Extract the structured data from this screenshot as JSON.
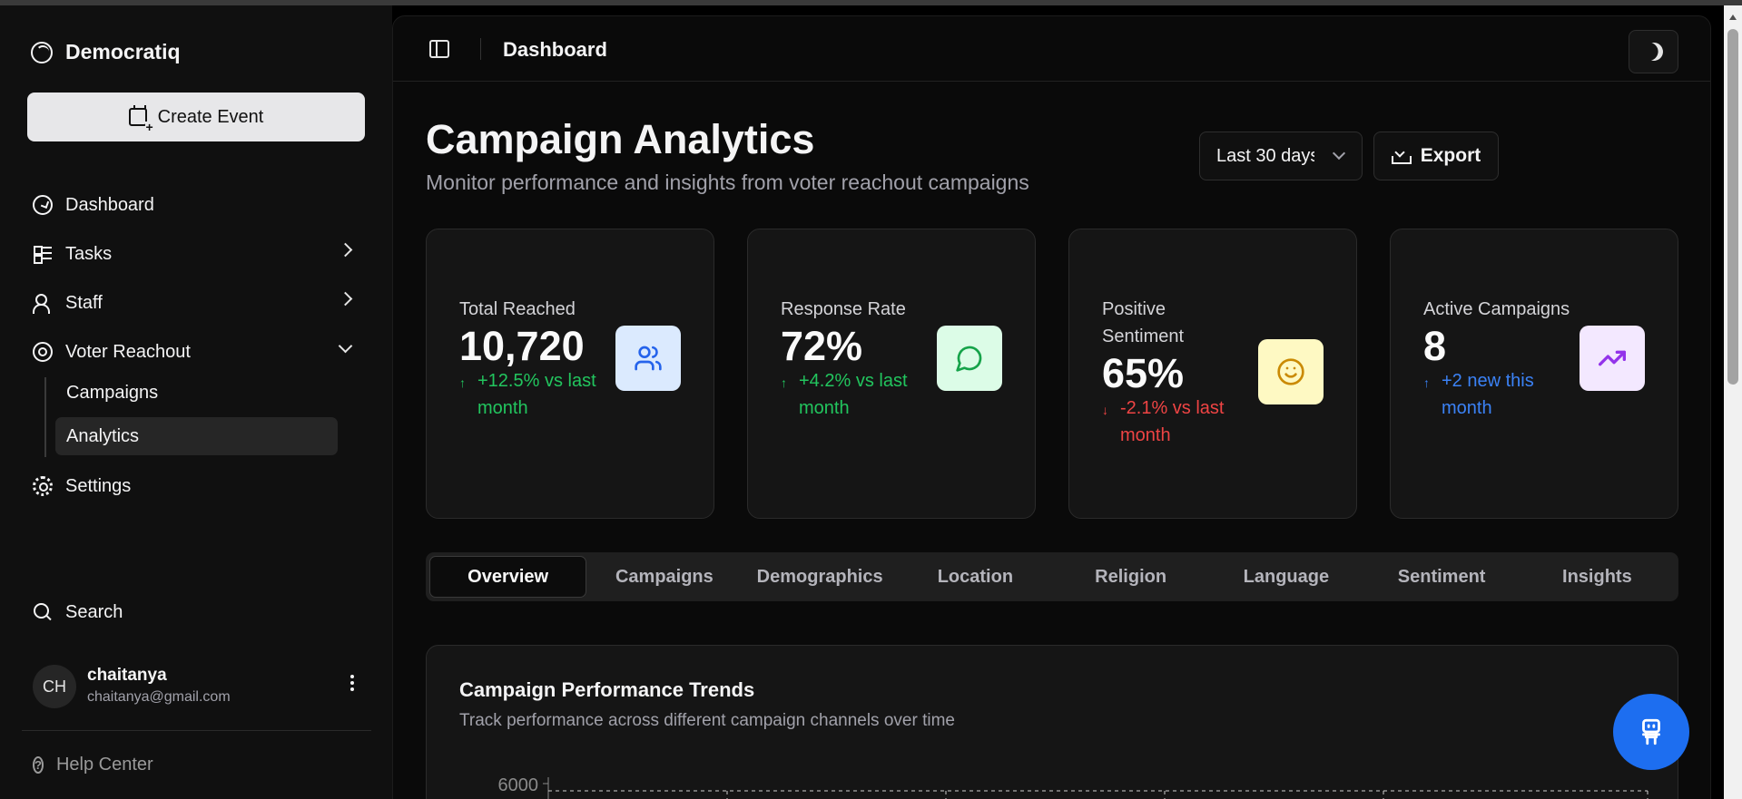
{
  "app": {
    "name": "Democratiq"
  },
  "sidebar": {
    "create_event": "Create Event",
    "items": [
      {
        "label": "Dashboard",
        "icon": "dashboard-icon"
      },
      {
        "label": "Tasks",
        "icon": "tasks-icon"
      },
      {
        "label": "Staff",
        "icon": "staff-icon"
      },
      {
        "label": "Voter Reachout",
        "icon": "target-icon"
      },
      {
        "label": "Settings",
        "icon": "gear-icon"
      }
    ],
    "voter_reachout_sub": [
      "Campaigns",
      "Analytics"
    ],
    "search": "Search",
    "user": {
      "initials": "CH",
      "name": "chaitanya",
      "email": "chaitanya@gmail.com"
    },
    "help": "Help Center"
  },
  "header": {
    "title": "Dashboard"
  },
  "page": {
    "title": "Campaign Analytics",
    "subtitle": "Monitor performance and insights from voter reachout campaigns",
    "range_value": "Last 30 days",
    "export_label": "Export"
  },
  "stats": [
    {
      "label": "Total Reached",
      "value": "10,720",
      "trend": "+12.5% vs last month",
      "direction": "up",
      "trend_color": "#22c55e",
      "icon": "users-icon",
      "icon_bg": "#dbeafe",
      "icon_color": "#2563eb"
    },
    {
      "label": "Response Rate",
      "value": "72%",
      "trend": "+4.2% vs last month",
      "direction": "up",
      "trend_color": "#22c55e",
      "icon": "message-icon",
      "icon_bg": "#dcfce7",
      "icon_color": "#16a34a"
    },
    {
      "label": "Positive Sentiment",
      "value": "65%",
      "trend": "-2.1% vs last month",
      "direction": "down",
      "trend_color": "#ef4444",
      "icon": "smile-icon",
      "icon_bg": "#fef9c3",
      "icon_color": "#ca8a04"
    },
    {
      "label": "Active Campaigns",
      "value": "8",
      "trend": "+2 new this month",
      "direction": "up",
      "trend_color": "#3b82f6",
      "icon": "trending-up-icon",
      "icon_bg": "#f3e8ff",
      "icon_color": "#9333ea"
    }
  ],
  "arrows": {
    "up": "↑",
    "down": "↓"
  },
  "tabs": [
    "Overview",
    "Campaigns",
    "Demographics",
    "Location",
    "Religion",
    "Language",
    "Sentiment",
    "Insights"
  ],
  "active_tab": "Overview",
  "chart": {
    "title": "Campaign Performance Trends",
    "subtitle": "Track performance across different campaign channels over time",
    "y_tick_top": "6000"
  },
  "colors": {
    "accent": "#1d6ef0",
    "background": "#000000"
  }
}
